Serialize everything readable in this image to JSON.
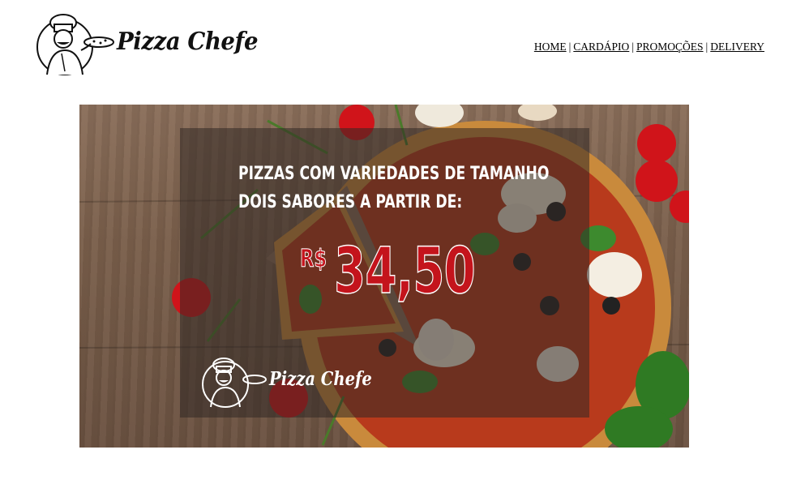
{
  "header": {
    "logo_text": "Pizza Chefe",
    "nav": [
      {
        "label": "HOME"
      },
      {
        "label": "CARDÁPIO"
      },
      {
        "label": "PROMOÇÕES"
      },
      {
        "label": "DELIVERY"
      }
    ],
    "separator": "|"
  },
  "banner": {
    "line1": "PIZZAS COM VARIEDADES DE TAMANHO",
    "line2": "DOIS SABORES A PARTIR DE:",
    "currency": "R$",
    "price": "34,50",
    "logo_text": "Pizza Chefe"
  },
  "colors": {
    "price_red": "#c4141c",
    "overlay": "rgba(50,40,36,0.55)",
    "wood": "#7a5f4b"
  }
}
